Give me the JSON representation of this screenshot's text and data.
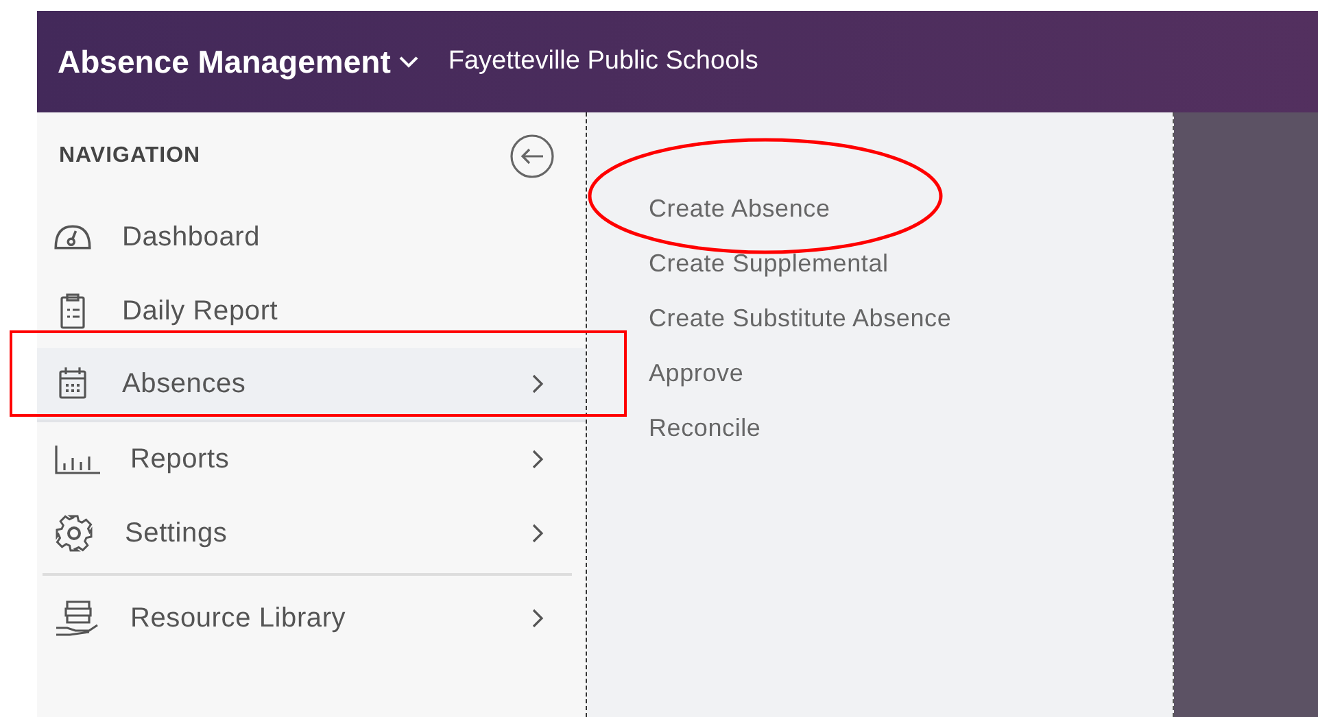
{
  "header": {
    "app_title": "Absence Management",
    "organization": "Fayetteville Public Schools"
  },
  "navigation": {
    "title": "NAVIGATION",
    "items": [
      {
        "label": "Dashboard",
        "has_submenu": false,
        "selected": false,
        "divider_before": false
      },
      {
        "label": "Daily Report",
        "has_submenu": false,
        "selected": false,
        "divider_before": false
      },
      {
        "label": "Absences",
        "has_submenu": true,
        "selected": true,
        "divider_before": false
      },
      {
        "label": "Reports",
        "has_submenu": true,
        "selected": false,
        "divider_before": false
      },
      {
        "label": "Settings",
        "has_submenu": true,
        "selected": false,
        "divider_before": false
      },
      {
        "label": "Resource Library",
        "has_submenu": true,
        "selected": false,
        "divider_before": true
      }
    ]
  },
  "submenu": {
    "items": [
      "Create Absence",
      "Create Supplemental",
      "Create Substitute Absence",
      "Approve",
      "Reconcile"
    ]
  }
}
